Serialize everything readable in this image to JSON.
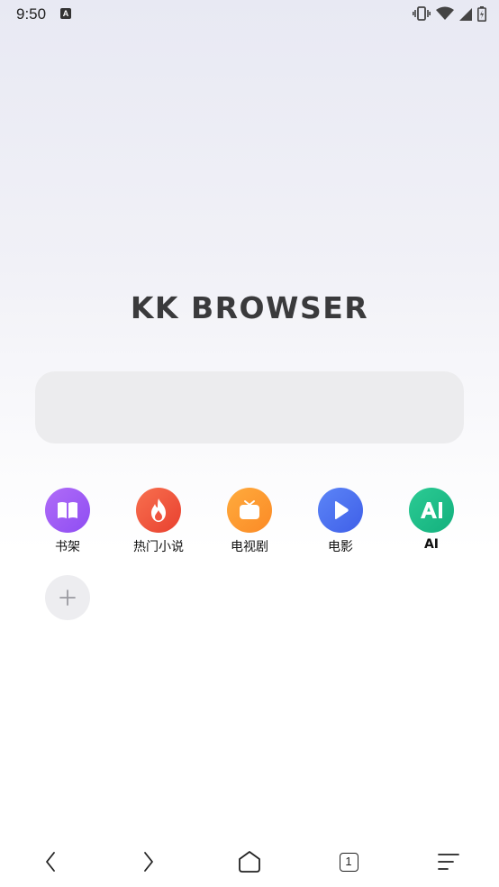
{
  "status_bar": {
    "time": "9:50",
    "notification_icon": "A",
    "icons": [
      "vibrate-icon",
      "wifi-icon",
      "signal-icon",
      "battery-icon"
    ]
  },
  "logo": "KK BROWSER",
  "search": {
    "placeholder": ""
  },
  "shortcuts": [
    {
      "label": "书架",
      "icon": "book-icon",
      "color": "#9b5cf5"
    },
    {
      "label": "热门小说",
      "icon": "flame-icon",
      "color": "#f0543f"
    },
    {
      "label": "电视剧",
      "icon": "tv-icon",
      "color": "#ff9a2e"
    },
    {
      "label": "电影",
      "icon": "play-icon",
      "color": "#4a72f0"
    },
    {
      "label": "AI",
      "icon": "ai-icon",
      "color": "#1fbf8a"
    }
  ],
  "add_shortcut": {
    "icon": "plus-icon"
  },
  "bottom_nav": {
    "back": "back-icon",
    "forward": "forward-icon",
    "home": "home-icon",
    "tab_count": "1",
    "menu": "menu-icon"
  }
}
